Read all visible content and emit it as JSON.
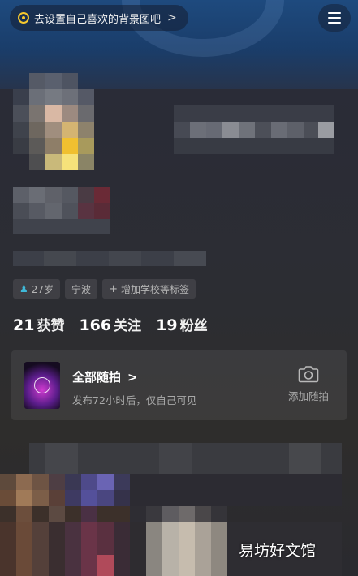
{
  "header": {
    "bg_tip": "去设置自己喜欢的背景图吧",
    "bg_tip_chevron": ">",
    "menu_icon": "hamburger-menu-icon"
  },
  "tags": {
    "age": "27岁",
    "location": "宁波",
    "add_tag": "增加学校等标签"
  },
  "stats": [
    {
      "num": "21",
      "label": "获赞"
    },
    {
      "num": "166",
      "label": "关注"
    },
    {
      "num": "19",
      "label": "粉丝"
    }
  ],
  "moments": {
    "title": "全部随拍",
    "title_chevron": ">",
    "subtitle": "发布72小时后，仅自己可见",
    "add_label": "添加随拍",
    "add_icon": "camera-icon"
  },
  "watermark": "易坊好文馆",
  "colors": {
    "accent_yellow": "#f5c82e",
    "age_icon": "#3fb9d9",
    "header_bg": "#1e4a7e",
    "page_bg": "#2a2c37"
  }
}
